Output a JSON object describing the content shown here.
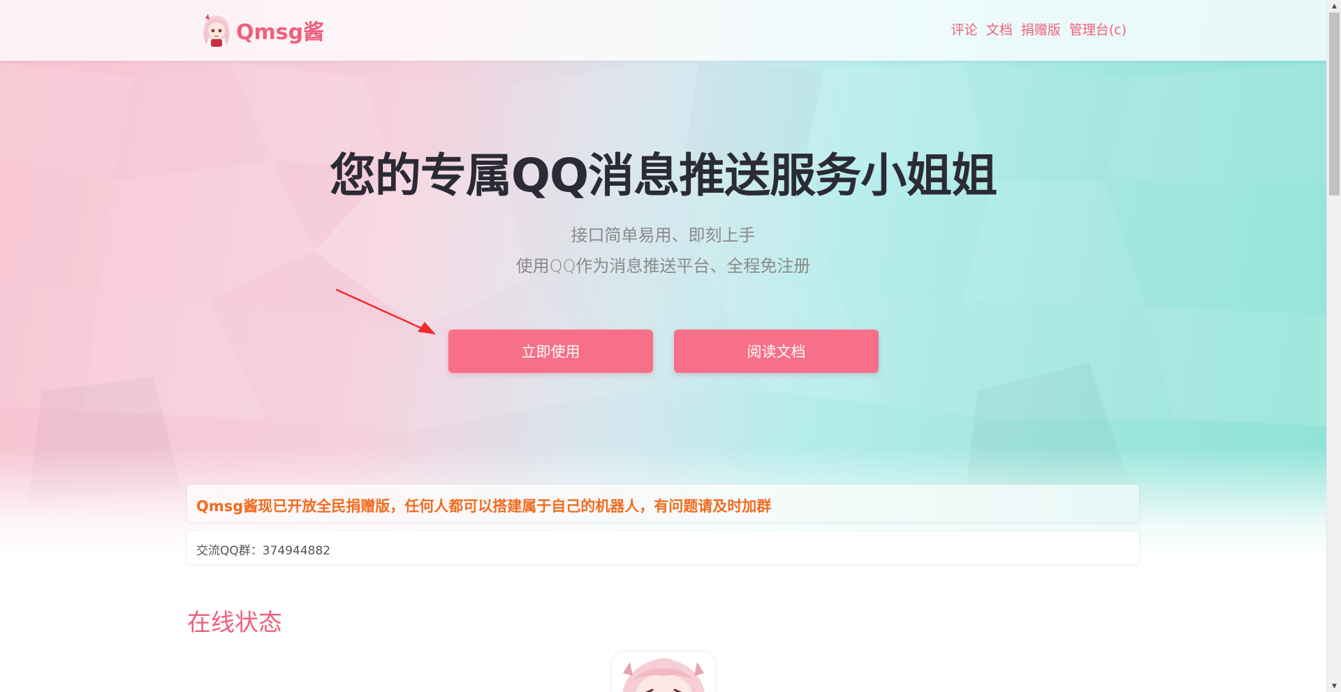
{
  "brand": {
    "name": "Qmsg酱",
    "accent_color": "#f0607e",
    "logo_icon": "anime-girl-avatar-icon"
  },
  "nav": {
    "items": [
      {
        "label": "评论"
      },
      {
        "label": "文档"
      },
      {
        "label": "捐赠版"
      },
      {
        "label": "管理台(c)"
      }
    ]
  },
  "hero": {
    "title": "您的专属QQ消息推送服务小姐姐",
    "subtitle_line1": "接口简单易用、即刻上手",
    "subtitle_line2": "使用QQ作为消息推送平台、全程免注册",
    "primary_button": "立即使用",
    "secondary_button": "阅读文档",
    "button_color": "#f76f88",
    "annotation": "red-arrow-pointing-to-primary-button"
  },
  "notice": {
    "headline": "Qmsg酱现已开放全民捐赠版，任何人都可以搭建属于自己的机器人，有问题请及时加群",
    "headline_color": "#f26b1e",
    "qq_group": "交流QQ群：374944882"
  },
  "status": {
    "heading": "在线状态"
  },
  "scrollbar": {
    "up_icon": "scroll-up-arrow-icon",
    "down_icon": "scroll-down-arrow-icon"
  }
}
